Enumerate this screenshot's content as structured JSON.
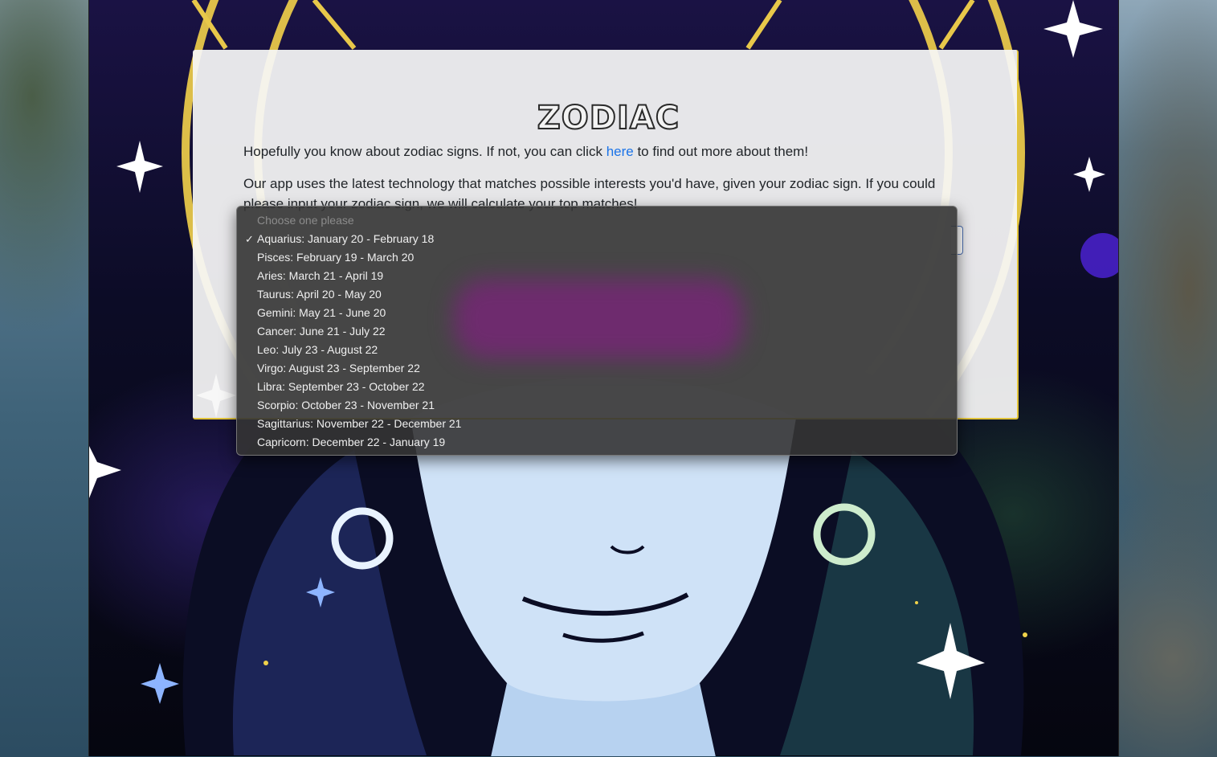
{
  "page": {
    "title": "ZODIAC",
    "intro_before_link": "Hopefully you know about zodiac signs. If not, you can click ",
    "intro_link": "here",
    "intro_after_link": " to find out more about them!",
    "description": "Our app uses the latest technology that matches possible interests you'd have, given your zodiac sign. If you could please input your zodiac sign, we will calculate your top matches!"
  },
  "select": {
    "placeholder": "Choose one please",
    "selected": "Aquarius: January 20 - February 18",
    "check_glyph": "✓",
    "options": [
      "Aquarius: January 20 - February 18",
      "Pisces: February 19 - March 20",
      "Aries: March 21 - April 19",
      "Taurus: April 20 - May 20",
      "Gemini: May 21 - June 20",
      "Cancer: June 21 - July 22",
      "Leo: July 23 - August 22",
      "Virgo: August 23 - September 22",
      "Libra: September 23 - October 22",
      "Scorpio: October 23 - November 21",
      "Sagittarius: November 22 - December 21",
      "Capricorn: December 22 - January 19"
    ]
  },
  "colors": {
    "accent_link": "#1a73e8",
    "card_border": "#e2c43a"
  }
}
